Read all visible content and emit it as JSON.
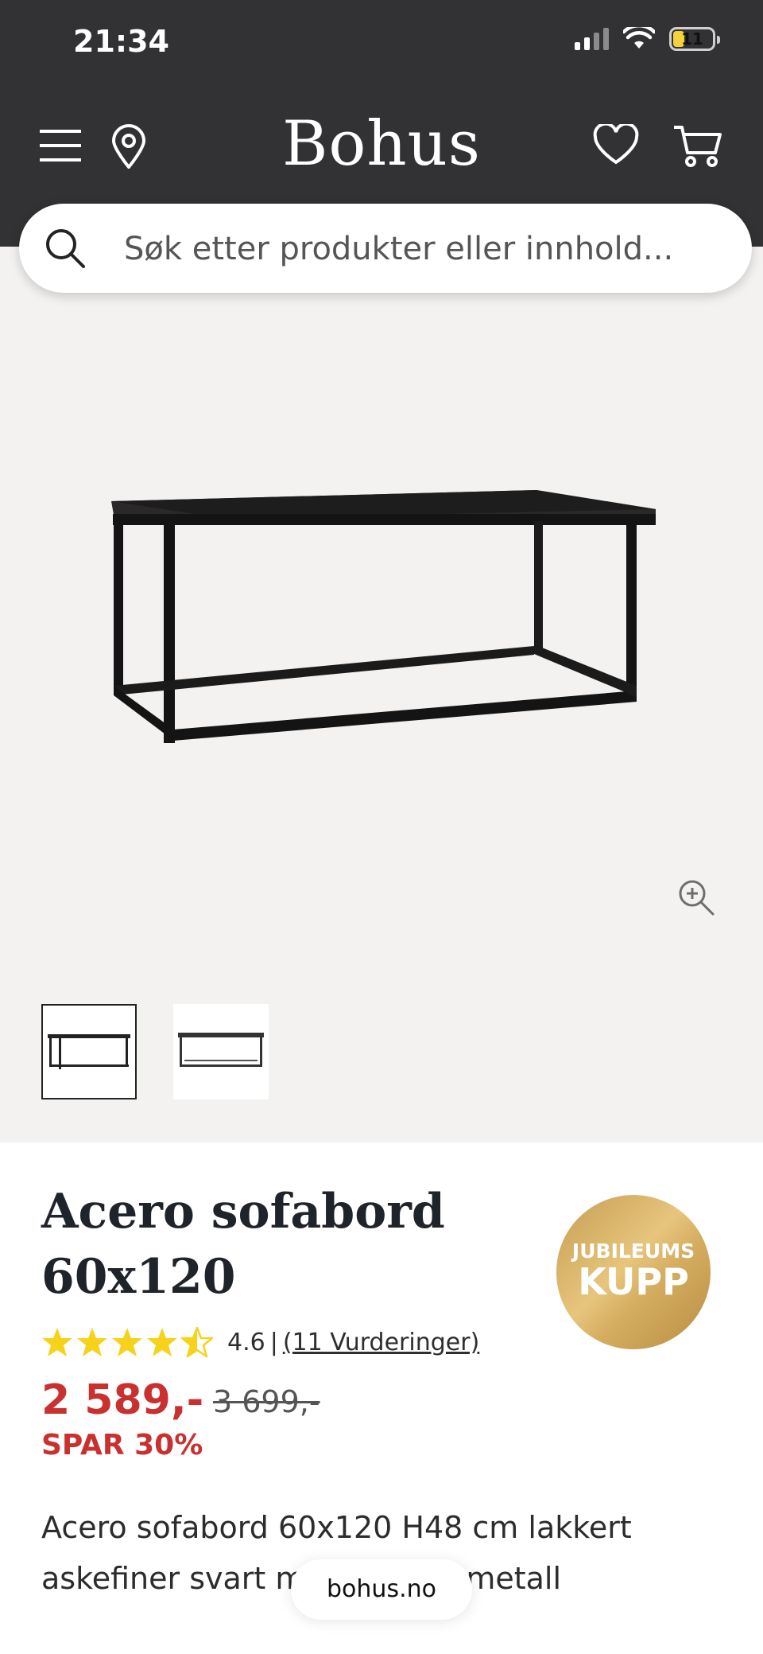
{
  "status_bar": {
    "time": "21:34",
    "battery": "11"
  },
  "header": {
    "logo": "Bohus"
  },
  "search": {
    "placeholder": "Søk etter produkter eller innhold..."
  },
  "product": {
    "title": "Acero sofabord 60x120",
    "badge_line1": "JUBILEUMS",
    "badge_line2": "KUPP",
    "rating_value": "4.6",
    "rating_separator": "|",
    "reviews_link": "(11 Vurderinger)",
    "rating_stars": 4.6,
    "price": "2 589,-",
    "old_price": "3 699,-",
    "save_label": "SPAR 30%",
    "description": "Acero sofabord 60x120 H48 cm lakkert askefiner svart metall svart metall"
  },
  "browser": {
    "url": "bohus.no"
  },
  "colors": {
    "header_bg": "#323235",
    "price_red": "#c8312f",
    "star_yellow": "#f6d31a",
    "badge_gold": "#d6ae62"
  }
}
